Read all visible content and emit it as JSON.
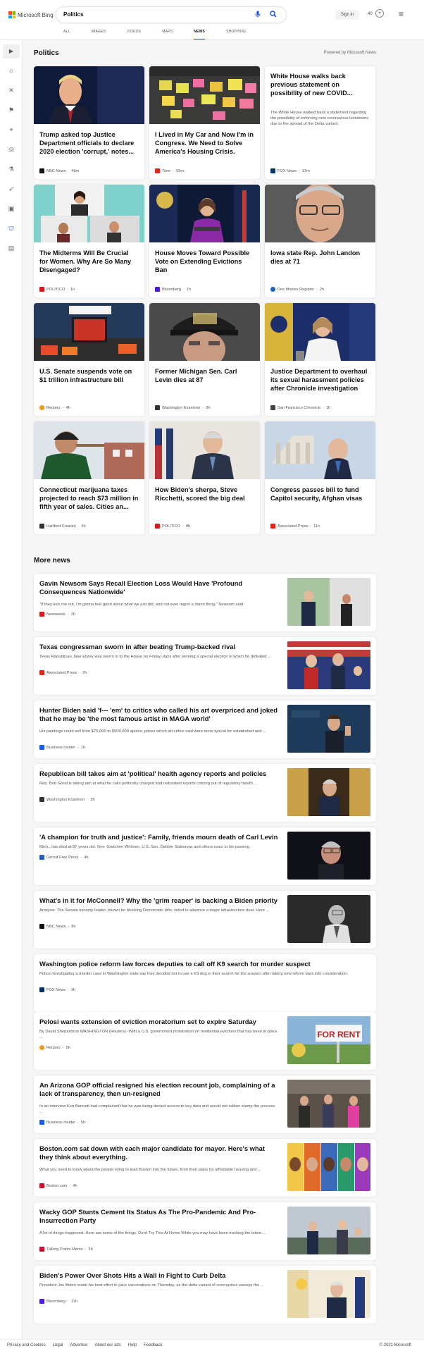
{
  "header": {
    "brand": "Microsoft Bing",
    "search_value": "Politics",
    "signin_label": "Sign in",
    "points": "40",
    "tabs": [
      {
        "label": "ALL",
        "active": false
      },
      {
        "label": "IMAGES",
        "active": false
      },
      {
        "label": "VIDEOS",
        "active": false
      },
      {
        "label": "MAPS",
        "active": false
      },
      {
        "label": "NEWS",
        "active": true
      },
      {
        "label": "SHOPPING",
        "active": false
      }
    ]
  },
  "rail": {
    "icons": [
      "expand-icon",
      "home-icon",
      "sports-icon",
      "flag-icon",
      "location-icon",
      "globe-icon",
      "science-icon",
      "rocket-icon",
      "entertainment-icon",
      "politics-icon",
      "money-icon"
    ],
    "active_index": 9
  },
  "politics": {
    "title": "Politics",
    "powered_by": "Powered by Microsoft News",
    "cards": [
      {
        "title": "Trump asked top Justice Department officials to declare 2020 election 'corrupt,' notes...",
        "source": "NBC News",
        "time": "49m",
        "color": "#111111"
      },
      {
        "title": "I Lived in My Car and Now I'm in Congress. We Need to Solve America's Housing Crisis.",
        "source": "Time",
        "time": "55m",
        "color": "#e1261c"
      },
      {
        "title": "White House walks back previous statement on possibility of new COVID...",
        "snippet": "The White House walked back a statement regarding the possibility of enforcing new coronavirus lockdowns due to the spread of the Delta variant.",
        "source": "FOX News",
        "time": "37m",
        "color": "#003366"
      },
      {
        "title": "The Midterms Will Be Crucial for Women. Why Are So Many Disengaged?",
        "source": "POLITICO",
        "time": "1h",
        "color": "#d71920"
      },
      {
        "title": "House Moves Toward Possible Vote on Extending Evictions Ban",
        "source": "Bloomberg",
        "time": "1h",
        "color": "#4a1ed8"
      },
      {
        "title": "Iowa state Rep. John Landon dies at 71",
        "source": "Des Moines Register",
        "time": "2h",
        "color": "#1f5fbf"
      },
      {
        "title": "U.S. Senate suspends vote on $1 trillion infrastructure bill",
        "source": "Reuters",
        "time": "4h",
        "color": "#f7941d"
      },
      {
        "title": "Former Michigan Sen. Carl Levin dies at 87",
        "source": "Washington Examiner",
        "time": "2h",
        "color": "#333333"
      },
      {
        "title": "Justice Department to overhaul its sexual harassment policies after Chronicle investigation",
        "source": "San Francisco Chronicle",
        "time": "1h",
        "color": "#444444"
      },
      {
        "title": "Connecticut marijuana taxes projected to reach $73 million in fifth year of sales. Cities an...",
        "source": "Hartford Courant",
        "time": "6h",
        "color": "#333333"
      },
      {
        "title": "How Biden's sherpa, Steve Ricchetti, scored the big deal",
        "source": "POLITICO",
        "time": "8h",
        "color": "#d71920"
      },
      {
        "title": "Congress passes bill to fund Capitol security, Afghan visas",
        "source": "Associated Press",
        "time": "11h",
        "color": "#e1261c"
      }
    ]
  },
  "more_news": {
    "title": "More news",
    "items": [
      {
        "title": "Gavin Newsom Says Recall Election Loss Would Have 'Profound Consequences Nationwide'",
        "snippet": "\"If they kick me out, I'm gonna feel good about what we just did, and not ever regret a damn thing,\" Newsom said.",
        "source": "Newsweek",
        "time": "2h",
        "color": "#d71920"
      },
      {
        "title": "Texas congressman sworn in after beating Trump-backed rival",
        "snippet": "Texas Republican Jake Ellzey was sworn in to the House on Friday, days after winning a special election in which he defeated ...",
        "source": "Associated Press",
        "time": "2h",
        "color": "#e1261c"
      },
      {
        "title": "Hunter Biden said 'f--- 'em' to critics who called his art overpriced and joked that he may be 'the most famous artist in MAGA world'",
        "snippet": "His paintings could sell from $75,000 to $500,000 apiece, prices which art critics said were more typical for established and ...",
        "source": "Business Insider",
        "time": "1h",
        "color": "#1a5cf0"
      },
      {
        "title": "Republican bill takes aim at 'political' health agency reports and policies",
        "snippet": "Rep. Bob Good is taking aim at what he calls politically charged and redundant reports coming out of regulatory health ...",
        "source": "Washington Examiner",
        "time": "3h",
        "color": "#333333"
      },
      {
        "title": "'A champion for truth and justice': Family, friends mourn death of Carl Levin",
        "snippet": "Mich., has died at 87 years old. Gov. Gretchen Whitmer, U.S. Sen. Debbie Stabenow and others react to his passing.",
        "source": "Detroit Free Press",
        "time": "4h",
        "color": "#1f5fbf"
      },
      {
        "title": "What's in it for McConnell? Why the 'grim reaper' is backing a Biden priority",
        "snippet": "Analysis: The Senate minority leader, known for blocking Democratic bills, voted to advance a major infrastructure deal. Here ...",
        "source": "NBC News",
        "time": "8h",
        "color": "#111111"
      },
      {
        "title": "Washington police reform law forces deputies to call off K9 search for murder suspect",
        "snippet": "Police investigating a murder case in Washington state say they decided not to use a K9 dog in their search for the suspect after taking new reform laws into consideration.",
        "source": "FOX News",
        "time": "3h",
        "color": "#003366"
      },
      {
        "title": "Pelosi wants extension of eviction moratorium set to expire Saturday",
        "snippet": "By David Shepardson WASHINGTON (Reuters) -With a U.S. government moratorium on residential evictions that has been in place ...",
        "source": "Reuters",
        "time": "5h",
        "color": "#f7941d"
      },
      {
        "title": "An Arizona GOP official resigned his election recount job, complaining of a lack of transparency, then un-resigned",
        "snippet": "In an interview Ken Bennett had complained that he was being denied access to key data and would not rubber stamp the process ...",
        "source": "Business Insider",
        "time": "5h",
        "color": "#1a5cf0"
      },
      {
        "title": "Boston.com sat down with each major candidate for mayor. Here's what they think about everything.",
        "snippet": "What you need to know about the people vying to lead Boston into the future, from their plans for affordable housing and ...",
        "source": "Boston.com",
        "time": "4h",
        "color": "#c8102e"
      },
      {
        "title": "Wacky GOP Stunts Cement Its Status As The Pro-Pandemic And Pro-Insurrection Party",
        "snippet": "A lot of things happened. Here are some of the things. Don't Try This At Home While you may have been tracking the latest ...",
        "source": "Talking Points Memo",
        "time": "5h",
        "color": "#c8102e"
      },
      {
        "title": "Biden's Power Over Shots Hits a Wall in Fight to Curb Delta",
        "snippet": "President Joe Biden made his best effort to juice vaccinations on Thursday, as the delta variant of coronavirus sweeps the ...",
        "source": "Bloomberg",
        "time": "11h",
        "color": "#4a1ed8"
      }
    ]
  },
  "footer": {
    "links": [
      "Privacy and Cookies",
      "Legal",
      "Advertise",
      "About our ads",
      "Help",
      "Feedback"
    ],
    "copyright": "© 2021 Microsoft"
  }
}
